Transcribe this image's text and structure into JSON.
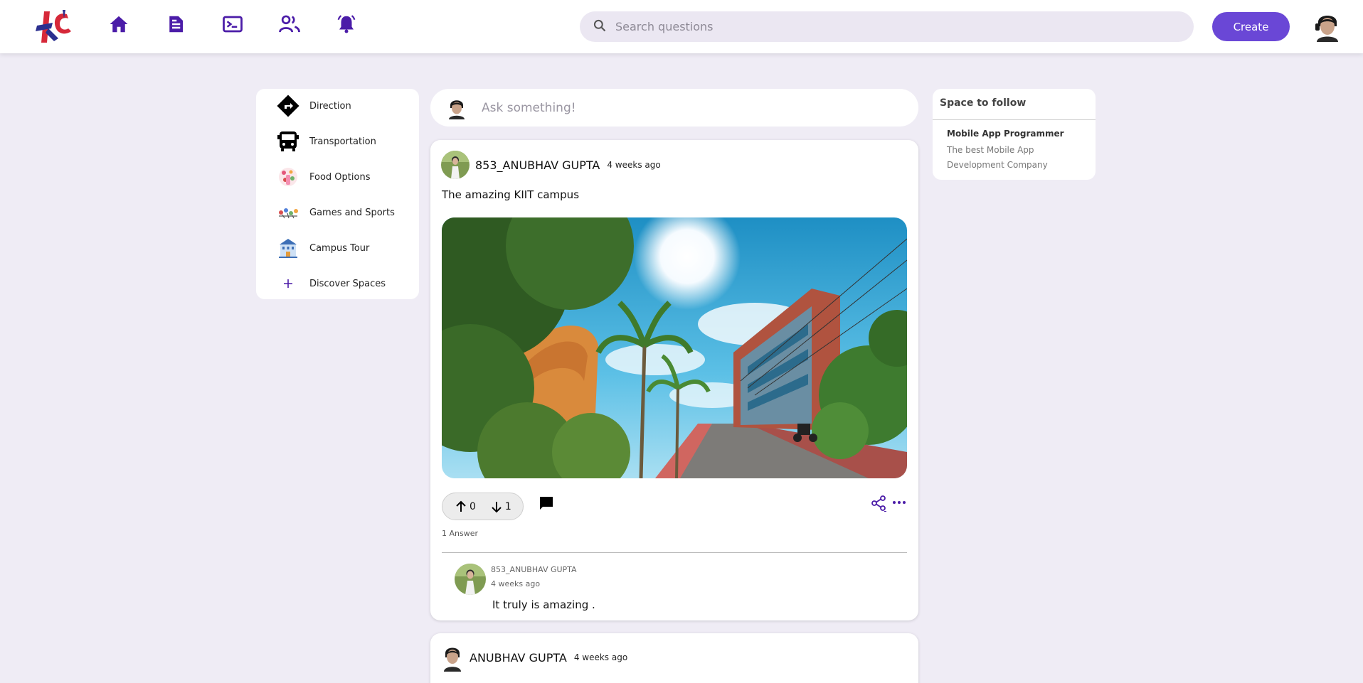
{
  "header": {
    "logo_icon": "kc-logo-icon",
    "nav": [
      {
        "name": "home-icon"
      },
      {
        "name": "document-icon"
      },
      {
        "name": "terminal-icon"
      },
      {
        "name": "people-icon"
      },
      {
        "name": "bell-icon"
      }
    ],
    "search_placeholder": "Search questions",
    "create_label": "Create",
    "accent": "#6a47d6",
    "nav_color": "#4b1ca8"
  },
  "sidebar": {
    "items": [
      {
        "label": "Direction",
        "icon": "direction-sign-icon"
      },
      {
        "label": "Transportation",
        "icon": "bus-icon"
      },
      {
        "label": "Food Options",
        "icon": "food-icon"
      },
      {
        "label": "Games and Sports",
        "icon": "sports-icon"
      },
      {
        "label": "Campus Tour",
        "icon": "campus-building-icon"
      },
      {
        "label": "Discover Spaces",
        "icon": "plus-icon"
      }
    ]
  },
  "ask": {
    "placeholder": "Ask something!"
  },
  "post": {
    "author": "853_ANUBHAV GUPTA",
    "time": "4 weeks ago",
    "title": "The amazing KIIT campus",
    "upvotes": "0",
    "downvotes": "1",
    "answer_count": "1 Answer",
    "answer": {
      "author": "853_ANUBHAV GUPTA",
      "time": "4 weeks ago",
      "text": "It truly is amazing ."
    }
  },
  "post2": {
    "author": "ANUBHAV GUPTA",
    "time": "4 weeks ago"
  },
  "widget": {
    "title": "Space to follow",
    "space_name": "Mobile App Programmer",
    "space_desc": "The best Mobile App Development Company"
  }
}
